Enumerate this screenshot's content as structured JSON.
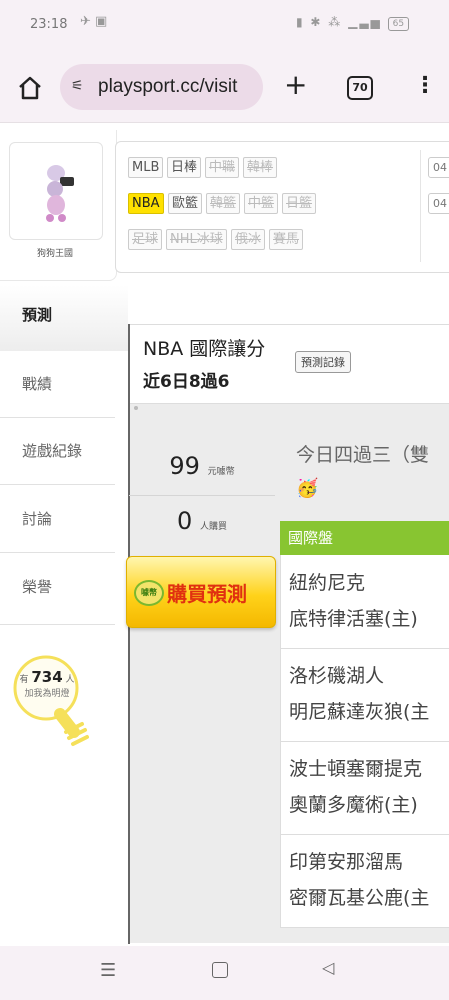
{
  "status_bar": {
    "time": "23:18",
    "battery": "65"
  },
  "browser": {
    "url": "playsport.cc/visit",
    "tab_count": "70"
  },
  "site": {
    "logo_name": "狗狗王國"
  },
  "sport_tags": {
    "row1": [
      {
        "label": "MLB",
        "state": "normal"
      },
      {
        "label": "日棒",
        "state": "normal"
      },
      {
        "label": "中職",
        "state": "disabled"
      },
      {
        "label": "韓棒",
        "state": "disabled"
      }
    ],
    "row2": [
      {
        "label": "NBA",
        "state": "selected"
      },
      {
        "label": "歐籃",
        "state": "normal"
      },
      {
        "label": "韓籃",
        "state": "disabled"
      },
      {
        "label": "中籃",
        "state": "disabled"
      },
      {
        "label": "日籃",
        "state": "disabled"
      }
    ],
    "row3": [
      {
        "label": "足球",
        "state": "disabled"
      },
      {
        "label": "NHL冰球",
        "state": "disabled"
      },
      {
        "label": "俄冰",
        "state": "disabled"
      },
      {
        "label": "賽馬",
        "state": "disabled"
      }
    ],
    "dates": [
      "04",
      "04"
    ]
  },
  "side_menu": {
    "active": "預測",
    "items": [
      "戰績",
      "遊戲紀錄",
      "討論",
      "榮譽"
    ]
  },
  "lightbulb": {
    "prefix": "有",
    "count": "734",
    "suffix": "人",
    "caption": "加我為明燈"
  },
  "prediction": {
    "title": "NBA 國際讓分",
    "record_button": "預測記錄",
    "streak": "近6日8過6",
    "price": "99",
    "price_unit": "元噱幣",
    "buyers": "0",
    "buyers_unit": "人購買",
    "buy_button": "購買預測",
    "buy_coin": "噱幣",
    "today_summary": "今日四過三（雙",
    "emoji": "🥳"
  },
  "games": {
    "header": "國際盤",
    "rows": [
      {
        "away": "紐約尼克",
        "home": "底特律活塞(主)"
      },
      {
        "away": "洛杉磯湖人",
        "home": "明尼蘇達灰狼(主"
      },
      {
        "away": "波士頓塞爾提克",
        "home": "奧蘭多魔術(主)"
      },
      {
        "away": "印第安那溜馬",
        "home": "密爾瓦基公鹿(主"
      }
    ]
  },
  "colors": {
    "accent_green": "#88c531",
    "tag_yellow": "#ffe100",
    "buy_red": "#e03010"
  }
}
